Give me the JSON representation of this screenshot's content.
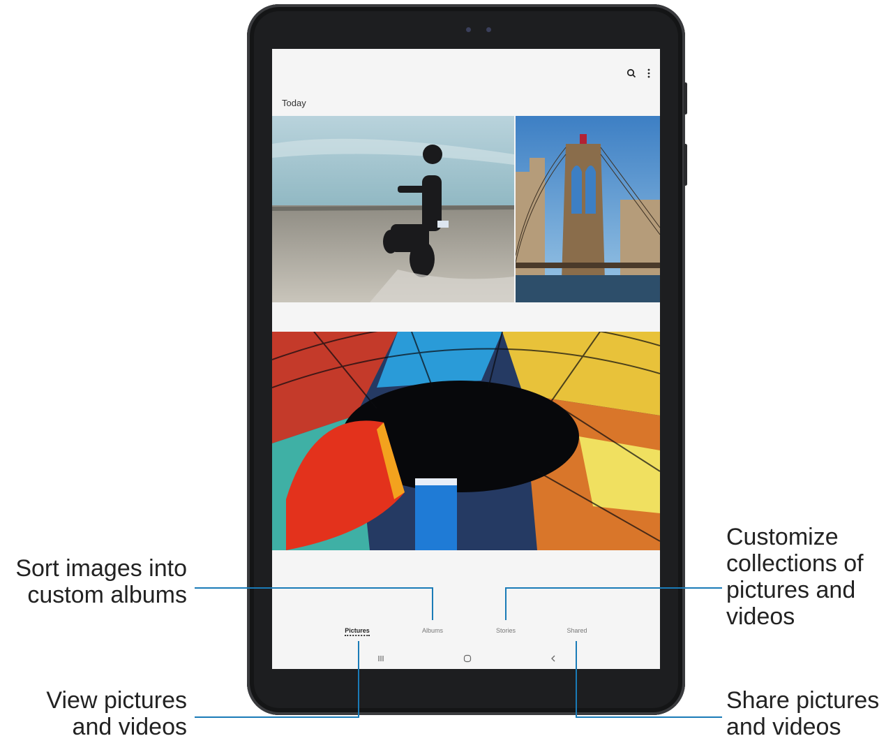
{
  "gallery": {
    "section_label": "Today",
    "toolbar": {
      "search_icon": "search-icon",
      "more_icon": "more-vert-icon"
    },
    "tabs": [
      {
        "label": "Pictures",
        "active": true
      },
      {
        "label": "Albums",
        "active": false
      },
      {
        "label": "Stories",
        "active": false
      },
      {
        "label": "Shared",
        "active": false
      }
    ],
    "nav": {
      "recents_icon": "recents-icon",
      "home_icon": "home-icon",
      "back_icon": "back-icon"
    }
  },
  "callouts": {
    "albums": "Sort images into\ncustom albums",
    "stories": "Customize\ncollections of\npictures and\nvideos",
    "pictures": "View pictures\nand videos",
    "shared": "Share pictures\nand videos"
  },
  "colors": {
    "callout_line": "#1a7bb7",
    "tablet": "#1d1e20",
    "screen_bg": "#f5f5f5"
  }
}
